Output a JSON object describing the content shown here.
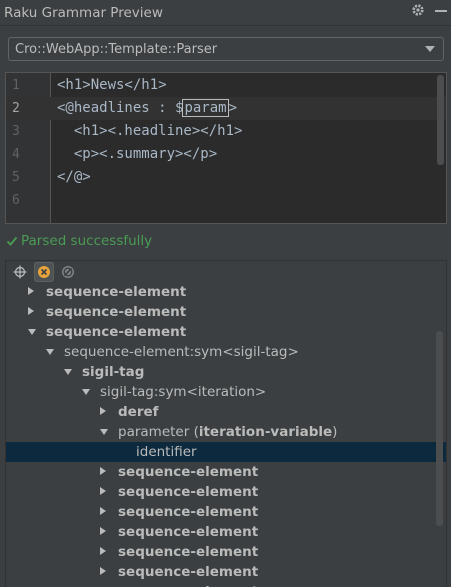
{
  "window": {
    "title": "Raku Grammar Preview"
  },
  "combo": {
    "selected": "Cro::WebApp::Template::Parser"
  },
  "editor": {
    "lines": [
      {
        "num": "1",
        "text": "<h1>News</h1>"
      },
      {
        "num": "2",
        "before": "<@headlines : $",
        "boxed": "param",
        "after": ">"
      },
      {
        "num": "3",
        "text": "  <h1><.headline></h1>"
      },
      {
        "num": "4",
        "text": "  <p><.summary></p>"
      },
      {
        "num": "5",
        "text": "</@>"
      },
      {
        "num": "6",
        "text": ""
      }
    ]
  },
  "status": {
    "icon": "check-icon",
    "text": "Parsed successfully",
    "color": "#499c54"
  },
  "tree": {
    "nodes": [
      {
        "label": "sequence-element"
      },
      {
        "label": "sequence-element"
      },
      {
        "label": "sequence-element"
      },
      {
        "label": "sequence-element:sym<sigil-tag>"
      },
      {
        "label": "sigil-tag"
      },
      {
        "label": "sigil-tag:sym<iteration>"
      },
      {
        "label": "deref"
      },
      {
        "label": "parameter",
        "paren_open": " (",
        "extra": "iteration-variable",
        "paren_close": ")"
      },
      {
        "label": "identifier"
      },
      {
        "label": "sequence-element"
      },
      {
        "label": "sequence-element"
      },
      {
        "label": "sequence-element"
      },
      {
        "label": "sequence-element"
      },
      {
        "label": "sequence-element"
      },
      {
        "label": "sequence-element"
      },
      {
        "label": "sequence-element"
      }
    ]
  },
  "colors": {
    "selection": "#0d293e",
    "accent_orange": "#e8a33b"
  }
}
